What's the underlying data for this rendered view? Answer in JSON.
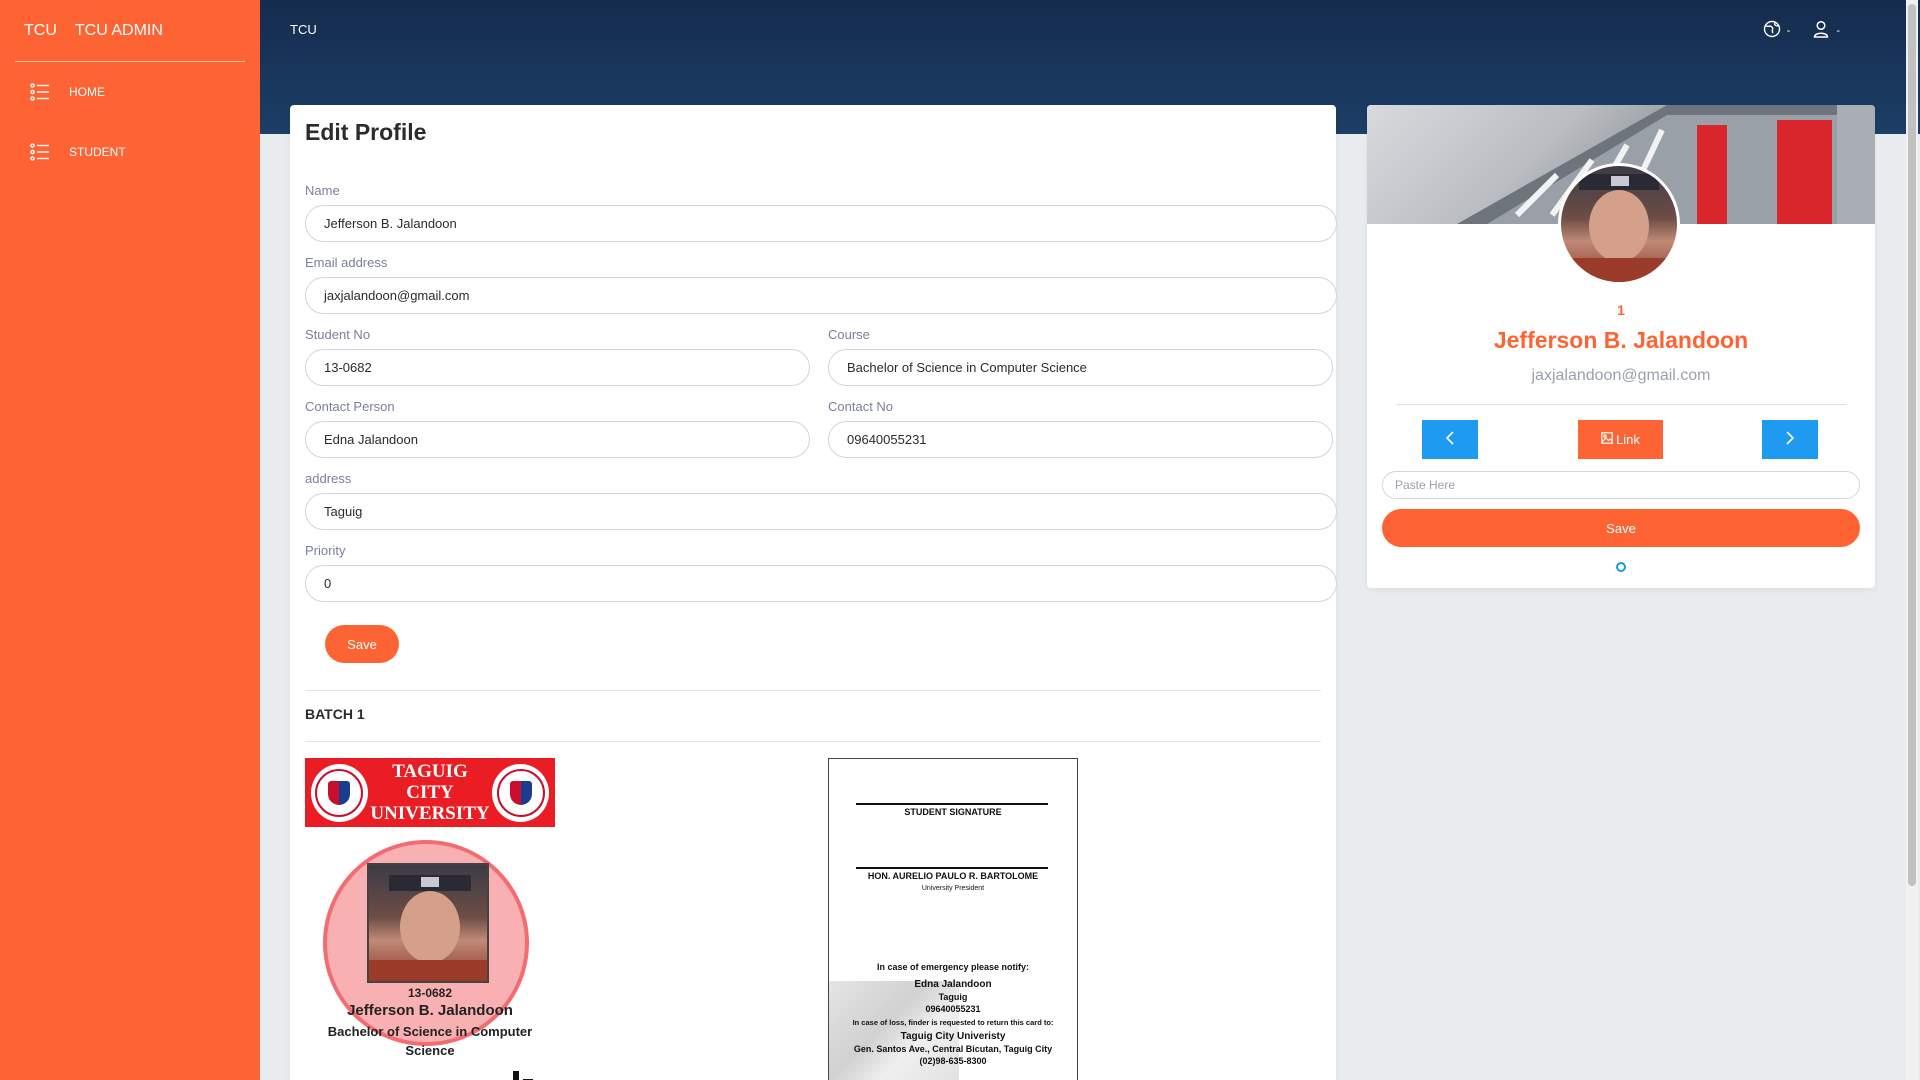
{
  "sidebar": {
    "brand_short": "TCU",
    "brand_name": "TCU ADMIN",
    "items": [
      {
        "label": "HOME",
        "icon": "list-icon"
      },
      {
        "label": "STUDENT",
        "icon": "list-icon"
      }
    ]
  },
  "topbar": {
    "title": "TCU",
    "icons": [
      "globe-icon",
      "user-icon"
    ],
    "caret": "-"
  },
  "form": {
    "heading": "Edit Profile",
    "name_label": "Name",
    "name_value": "Jefferson B. Jalandoon",
    "email_label": "Email address",
    "email_value": "jaxjalandoon@gmail.com",
    "student_no_label": "Student No",
    "student_no_value": "13-0682",
    "course_label": "Course",
    "course_value": "Bachelor of Science in Computer Science",
    "contact_person_label": "Contact Person",
    "contact_person_value": "Edna Jalandoon",
    "contact_no_label": "Contact No",
    "contact_no_value": "09640055231",
    "address_label": "address",
    "address_value": "Taguig",
    "priority_label": "Priority",
    "priority_value": "0",
    "save_label": "Save",
    "batch_label": "BATCH 1"
  },
  "id_front": {
    "university_line1": "TAGUIG CITY",
    "university_line2": "UNIVERSITY",
    "watermark": "TAGUIG CITY UNIVERSITY",
    "student_no": "13-0682",
    "name": "Jefferson B. Jalandoon",
    "course": "Bachelor of Science in Computer Science"
  },
  "id_back": {
    "signature_label": "STUDENT SIGNATURE",
    "president_name": "HON. AURELIO PAULO R. BARTOLOME",
    "president_title": "University President",
    "emergency_label": "In case of emergency please notify:",
    "contact_name": "Edna Jalandoon",
    "contact_address": "Taguig",
    "contact_no": "09640055231",
    "loss_text": "In case of loss, finder is requested to return this card to:",
    "school": "Taguig City Univeristy",
    "school_address": "Gen. Santos Ave., Central Bicutan, Taguig City",
    "school_phone": "(02)98-635-8300"
  },
  "profile": {
    "number": "1",
    "name": "Jefferson B. Jalandoon",
    "email": "jaxjalandoon@gmail.com",
    "prev_label": "‹",
    "link_label": "Link",
    "next_label": "›",
    "paste_placeholder": "Paste Here",
    "save_label": "Save",
    "colors": {
      "accent": "#fe6433",
      "nav_button": "#1e9bf0"
    }
  }
}
